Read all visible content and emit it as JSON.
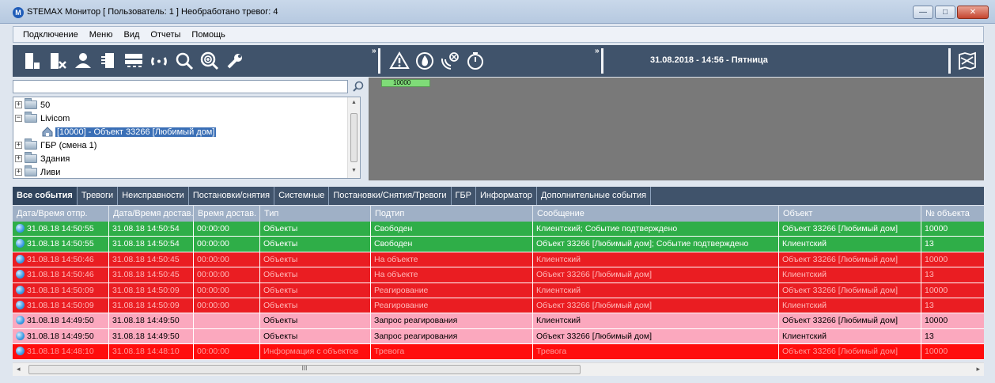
{
  "window": {
    "app_icon_letter": "M",
    "title": "STEMAX Монитор [ Пользователь: 1 ] Необработано тревог: 4",
    "minimize": "—",
    "maximize": "□",
    "close": "✕"
  },
  "menu": [
    "Подключение",
    "Меню",
    "Вид",
    "Отчеты",
    "Помощь"
  ],
  "toolbar": {
    "group1_icons": [
      "connect-icon",
      "disconnect-icon",
      "users-icon",
      "devices-icon",
      "objects-list-icon",
      "refresh-icon",
      "search-icon",
      "zoom-in-icon",
      "settings-wrench-icon"
    ],
    "group2_icons": [
      "alarm-warning-icon",
      "fire-icon",
      "signal-off-icon",
      "timer-icon"
    ],
    "overflow": "»",
    "datetime": "31.08.2018 - 14:56 - Пятница",
    "map_icon": "map-icon"
  },
  "search": {
    "value": "",
    "placeholder": ""
  },
  "tree": [
    {
      "label": "50",
      "expander": "+",
      "level": 0
    },
    {
      "label": "Livicom",
      "expander": "−",
      "level": 0
    },
    {
      "label": "[10000] - Объект 33266 [Любимый дом]",
      "level": 1,
      "selected": true
    },
    {
      "label": "ГБР (смена 1)",
      "expander": "+",
      "level": 0
    },
    {
      "label": "Здания",
      "expander": "+",
      "level": 0
    },
    {
      "label": "Ливи",
      "expander": "+",
      "level": 0
    }
  ],
  "map": {
    "tile_label": "10000",
    "tile_color": "#7fdc78"
  },
  "tabs": [
    "Все события",
    "Тревоги",
    "Неисправности",
    "Постановки/снятия",
    "Системные",
    "Постановки/Снятия/Тревоги",
    "ГБР",
    "Информатор",
    "Дополнительные события"
  ],
  "active_tab": 0,
  "table": {
    "columns": [
      "Дата/Время отпр.",
      "Дата/Время достав.",
      "Время достав.",
      "Тип",
      "Подтип",
      "Сообщение",
      "Объект",
      "№ объекта"
    ],
    "rows": [
      {
        "style": "green",
        "cells": [
          "31.08.18 14:50:55",
          "31.08.18 14:50:54",
          "00:00:00",
          "Объекты",
          "Свободен",
          "Клиентский; Событие подтверждено",
          "Объект 33266 [Любимый дом]",
          "10000"
        ]
      },
      {
        "style": "green",
        "cells": [
          "31.08.18 14:50:55",
          "31.08.18 14:50:54",
          "00:00:00",
          "Объекты",
          "Свободен",
          "Объект 33266 [Любимый дом]; Событие подтверждено",
          "Клиентский",
          "13"
        ]
      },
      {
        "style": "red",
        "cells": [
          "31.08.18 14:50:46",
          "31.08.18 14:50:45",
          "00:00:00",
          "Объекты",
          "На объекте",
          "Клиентский",
          "Объект 33266 [Любимый дом]",
          "10000"
        ]
      },
      {
        "style": "red",
        "cells": [
          "31.08.18 14:50:46",
          "31.08.18 14:50:45",
          "00:00:00",
          "Объекты",
          "На объекте",
          "Объект 33266 [Любимый дом]",
          "Клиентский",
          "13"
        ]
      },
      {
        "style": "red",
        "cells": [
          "31.08.18 14:50:09",
          "31.08.18 14:50:09",
          "00:00:00",
          "Объекты",
          "Реагирование",
          "Клиентский",
          "Объект 33266 [Любимый дом]",
          "10000"
        ]
      },
      {
        "style": "red",
        "cells": [
          "31.08.18 14:50:09",
          "31.08.18 14:50:09",
          "00:00:00",
          "Объекты",
          "Реагирование",
          "Объект 33266 [Любимый дом]",
          "Клиентский",
          "13"
        ]
      },
      {
        "style": "pink",
        "cells": [
          "31.08.18 14:49:50",
          "31.08.18 14:49:50",
          "",
          "Объекты",
          "Запрос реагирования",
          "Клиентский",
          "Объект 33266 [Любимый дом]",
          "10000"
        ]
      },
      {
        "style": "pink",
        "cells": [
          "31.08.18 14:49:50",
          "31.08.18 14:49:50",
          "",
          "Объекты",
          "Запрос реагирования",
          "Объект 33266 [Любимый дом]",
          "Клиентский",
          "13"
        ]
      },
      {
        "style": "alarm",
        "cells": [
          "31.08.18 14:48:10",
          "31.08.18 14:48:10",
          "00:00:00",
          "Информация с объектов",
          "Тревога",
          "Тревога",
          "Объект 33266 [Любимый дом]",
          "10000"
        ]
      }
    ]
  },
  "scrollbar": {
    "grip": "III",
    "left_arrow": "◂",
    "right_arrow": "▸"
  }
}
